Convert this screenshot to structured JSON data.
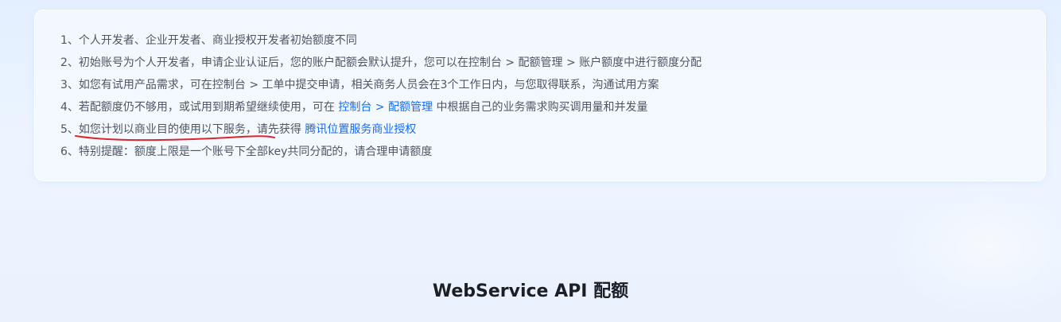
{
  "notice": {
    "items": [
      {
        "prefix": "1、个人开发者、企业开发者、商业授权开发者初始额度不同"
      },
      {
        "prefix": "2、初始账号为个人开发者，申请企业认证后，您的账户配额会默认提升，您可以在控制台 > 配额管理 > 账户额度中进行额度分配"
      },
      {
        "prefix": "3、如您有试用产品需求，可在控制台 > 工单中提交申请，相关商务人员会在3个工作日内，与您取得联系，沟通试用方案"
      },
      {
        "prefix": "4、若配额度仍不够用，或试用到期希望继续使用，可在 ",
        "link_console": "控制台",
        "separator": " > ",
        "link_quota": "配额管理",
        "suffix": " 中根据自己的业务需求购买调用量和并发量"
      },
      {
        "number": "5、",
        "highlight": "如您计划以商业目的使用以下服务",
        "middle": "，请先获得 ",
        "link_license": "腾讯位置服务商业授权"
      },
      {
        "prefix": "6、特别提醒：额度上限是一个账号下全部key共同分配的，请合理申请额度"
      }
    ],
    "annotation_color": "#d9272e",
    "link_color": "#1a6cf0"
  },
  "section": {
    "title": "WebService API 配额"
  }
}
